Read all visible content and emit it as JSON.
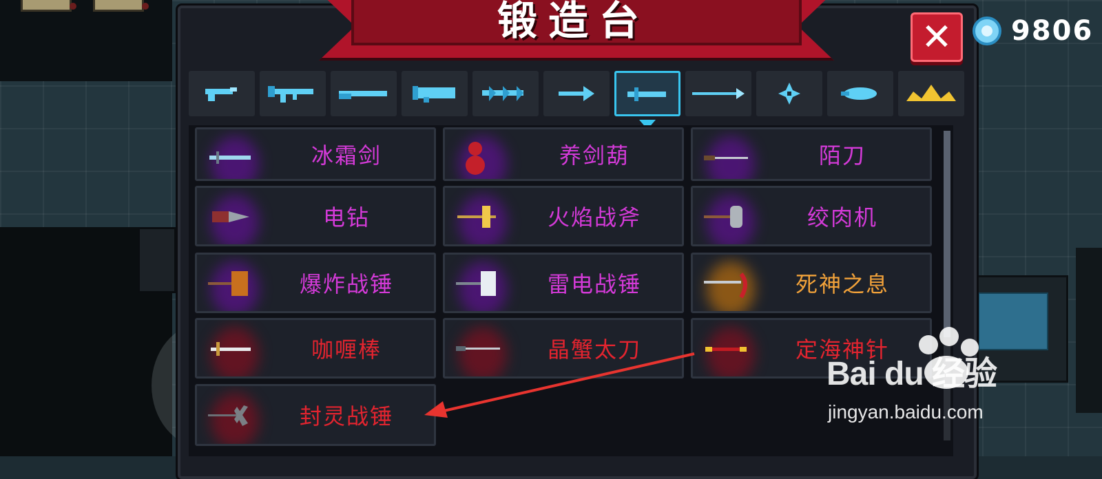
{
  "header": {
    "title": "锻造台",
    "close_label": "✕",
    "gem_count": "9806"
  },
  "tabs": [
    {
      "icon": "pistol-icon",
      "selected": false
    },
    {
      "icon": "assault-rifle-icon",
      "selected": false
    },
    {
      "icon": "shotgun-icon",
      "selected": false
    },
    {
      "icon": "rocket-launcher-icon",
      "selected": false
    },
    {
      "icon": "heavy-gun-icon",
      "selected": false
    },
    {
      "icon": "bow-icon",
      "selected": false
    },
    {
      "icon": "melee-sword-icon",
      "selected": true
    },
    {
      "icon": "spear-icon",
      "selected": false
    },
    {
      "icon": "shuriken-icon",
      "selected": false
    },
    {
      "icon": "staff-icon",
      "selected": false
    },
    {
      "icon": "special-crown-icon",
      "selected": false
    }
  ],
  "items": [
    {
      "name": "冰霜剑",
      "rarity_color": "#d43ad8",
      "icon": "ice-sword-icon"
    },
    {
      "name": "养剑葫",
      "rarity_color": "#d43ad8",
      "icon": "gourd-icon"
    },
    {
      "name": "陌刀",
      "rarity_color": "#d43ad8",
      "icon": "long-blade-icon"
    },
    {
      "name": "电钻",
      "rarity_color": "#d43ad8",
      "icon": "drill-icon"
    },
    {
      "name": "火焰战斧",
      "rarity_color": "#d43ad8",
      "icon": "fire-axe-icon"
    },
    {
      "name": "绞肉机",
      "rarity_color": "#d43ad8",
      "icon": "grinder-icon"
    },
    {
      "name": "爆炸战锤",
      "rarity_color": "#d43ad8",
      "icon": "explosive-hammer-icon"
    },
    {
      "name": "雷电战锤",
      "rarity_color": "#d43ad8",
      "icon": "thunder-hammer-icon"
    },
    {
      "name": "死神之息",
      "rarity_color": "#f2a23a",
      "icon": "scythe-icon"
    },
    {
      "name": "咖喱棒",
      "rarity_color": "#e3242f",
      "icon": "curry-stick-icon"
    },
    {
      "name": "晶蟹太刀",
      "rarity_color": "#e3242f",
      "icon": "crystal-katana-icon"
    },
    {
      "name": "定海神针",
      "rarity_color": "#e3242f",
      "icon": "golden-staff-icon"
    },
    {
      "name": "封灵战锤",
      "rarity_color": "#e3242f",
      "icon": "seal-hammer-icon"
    }
  ],
  "watermark": {
    "brand": "Bai du 经验",
    "url": "jingyan.baidu.com"
  },
  "colors": {
    "accent": "#39c6f0",
    "banner": "#b0142a",
    "purple": "#d43ad8",
    "orange": "#f2a23a",
    "red": "#e3242f"
  }
}
